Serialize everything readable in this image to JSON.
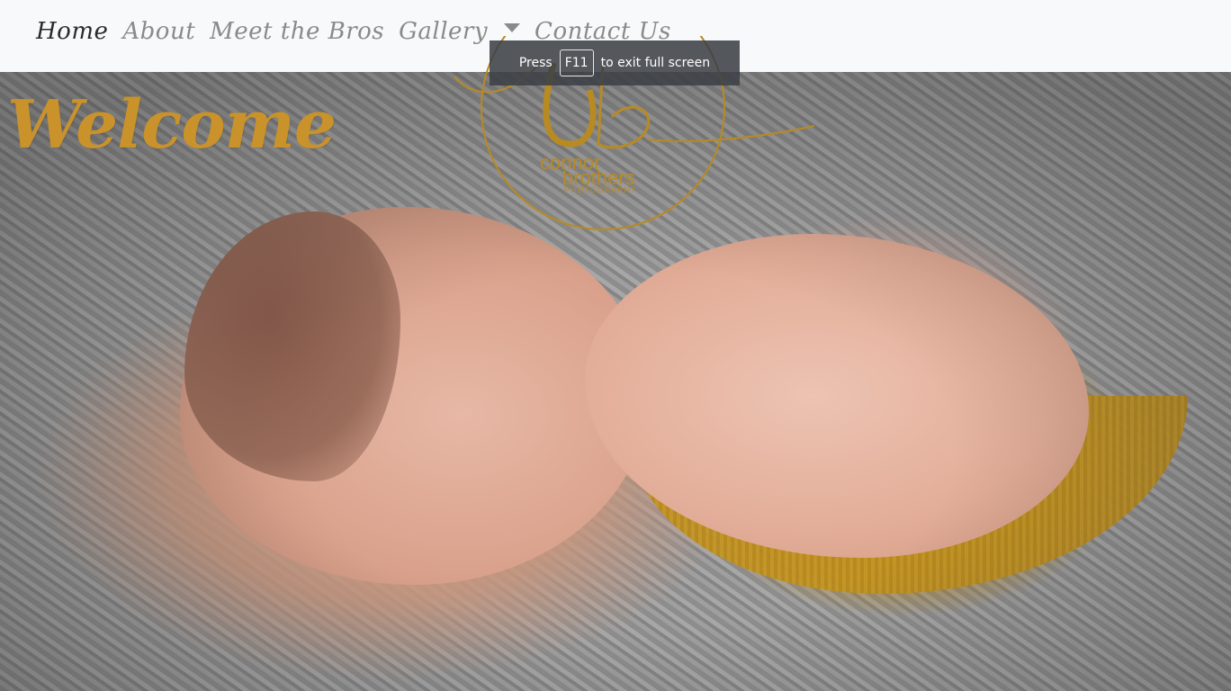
{
  "nav": {
    "items": [
      {
        "label": "Home",
        "active": true
      },
      {
        "label": "About",
        "active": false
      },
      {
        "label": "Meet the Bros",
        "active": false
      },
      {
        "label": "Gallery",
        "active": false,
        "has_dropdown": true
      },
      {
        "label": "Contact Us",
        "active": false
      }
    ],
    "dropdown_icon": "caret-down-icon"
  },
  "hero": {
    "heading": "Welcome",
    "logo": {
      "line1": "connor",
      "line2": "brothers",
      "line3": "PHOTOGRAPHY"
    }
  },
  "fullscreen_notice": {
    "prefix": "Press",
    "key": "F11",
    "suffix": "to exit full screen"
  },
  "colors": {
    "accent_gold": "#c9922a",
    "nav_text": "#8a8a8a",
    "nav_active": "#2b2b2b",
    "navbar_bg": "#f8f9fa"
  }
}
